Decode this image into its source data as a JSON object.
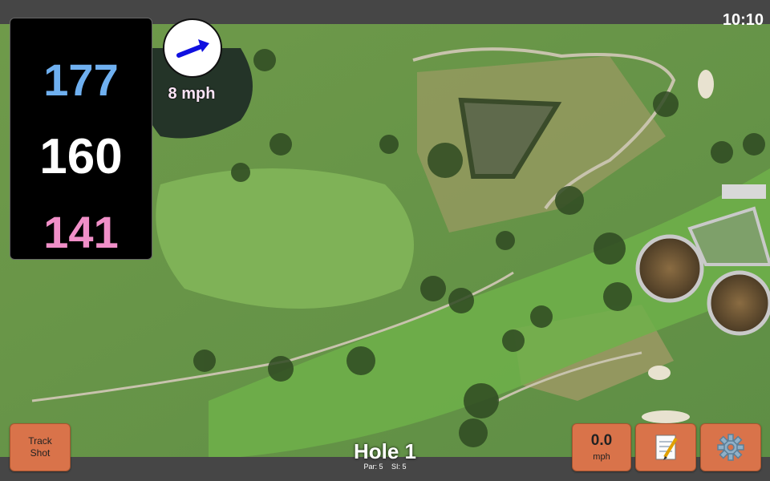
{
  "status": {
    "time": "10:10"
  },
  "distances": {
    "back": "177",
    "middle": "160",
    "front": "141"
  },
  "wind": {
    "speed": "8 mph",
    "direction_icon": "arrow-icon",
    "arrow_color": "#1010e0"
  },
  "hole": {
    "title": "Hole 1",
    "par": "Par: 5",
    "si": "SI: 5"
  },
  "buttons": {
    "track_shot": "Track\nShot",
    "speed_value": "0.0",
    "speed_unit": "mph",
    "notes_icon": "notepad-icon",
    "settings_icon": "gear-icon"
  },
  "colors": {
    "button": "#d9734a",
    "back_dist": "#6fb0f0",
    "front_dist": "#f08fc8",
    "wind_text": "#fbe4f6"
  }
}
